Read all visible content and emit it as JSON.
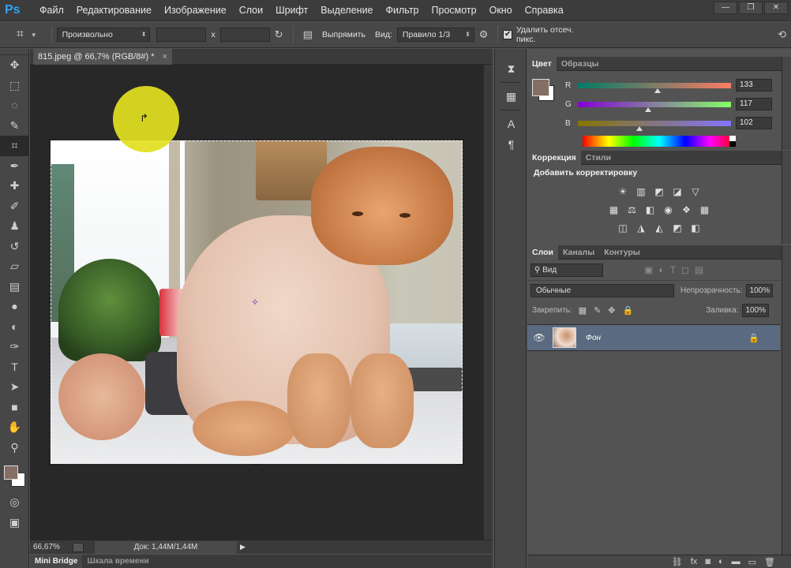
{
  "app": {
    "logo": "Ps",
    "menu": [
      "Файл",
      "Редактирование",
      "Изображение",
      "Слои",
      "Шрифт",
      "Выделение",
      "Фильтр",
      "Просмотр",
      "Окно",
      "Справка"
    ],
    "window_controls": [
      "—",
      "❐",
      "✕"
    ]
  },
  "options": {
    "tool_icon": "crop-icon",
    "ratio_select": "Произвольно",
    "swap_label": "x",
    "straighten_label": "Выпрямить",
    "view_label": "Вид:",
    "view_select": "Правило 1/3",
    "delete_cropped_label": "Удалить отсеч. пикс.",
    "delete_cropped_checked": true
  },
  "tools": [
    "move",
    "marquee",
    "lasso",
    "quick-select",
    "crop",
    "eyedropper",
    "healing",
    "brush",
    "stamp",
    "history-brush",
    "eraser",
    "gradient",
    "blur",
    "dodge",
    "pen",
    "type",
    "path-select",
    "shape",
    "hand",
    "zoom"
  ],
  "tool_glyphs": [
    "✥",
    "⬚",
    "◌",
    "✎",
    "⌗",
    "✒",
    "✚",
    "✐",
    "♟",
    "↺",
    "▱",
    "▤",
    "●",
    "◐",
    "✑",
    "T",
    "➤",
    "■",
    "✋",
    "⚲"
  ],
  "colors": {
    "foreground": "#856f65",
    "background": "#ffffff"
  },
  "document": {
    "tab_title": "815.jpeg @ 66,7% (RGB/8#) *",
    "close": "×"
  },
  "status": {
    "zoom": "66,67%",
    "doc_size": "Док: 1,44M/1,44M"
  },
  "bottom_tabs": [
    "Mini Bridge",
    "Шкала времени"
  ],
  "color_panel": {
    "tabs": [
      "Цвет",
      "Образцы"
    ],
    "sliders": [
      {
        "label": "R",
        "value": "133",
        "fraction": 0.52,
        "gradient": "linear-gradient(90deg,#007c66,#ff7c66)"
      },
      {
        "label": "G",
        "value": "117",
        "fraction": 0.46,
        "gradient": "linear-gradient(90deg,#8500d6,#85ff66)"
      },
      {
        "label": "B",
        "value": "102",
        "fraction": 0.4,
        "gradient": "linear-gradient(90deg,#857500,#8575ff)"
      }
    ]
  },
  "adjustments_panel": {
    "tabs": [
      "Коррекция",
      "Стили"
    ],
    "title": "Добавить корректировку",
    "row1": [
      "☀",
      "▥",
      "◩",
      "◪",
      "▽"
    ],
    "row2": [
      "▦",
      "⚖",
      "◧",
      "◉",
      "❖",
      "▦"
    ],
    "row3": [
      "◫",
      "◮",
      "◭",
      "◩",
      "◧"
    ]
  },
  "layers_panel": {
    "tabs": [
      "Слои",
      "Каналы",
      "Контуры"
    ],
    "kind_filter": "⚲ Вид",
    "blend_mode": "Обычные",
    "opacity_label": "Непрозрачность:",
    "opacity_value": "100%",
    "lock_label": "Закрепить:",
    "fill_label": "Заливка:",
    "fill_value": "100%",
    "layers": [
      {
        "name": "Фон",
        "visible": true,
        "locked": true
      }
    ],
    "bottom_icons": [
      "⛓",
      "fx",
      "◙",
      "◐",
      "▬",
      "▭",
      "🗑"
    ]
  }
}
